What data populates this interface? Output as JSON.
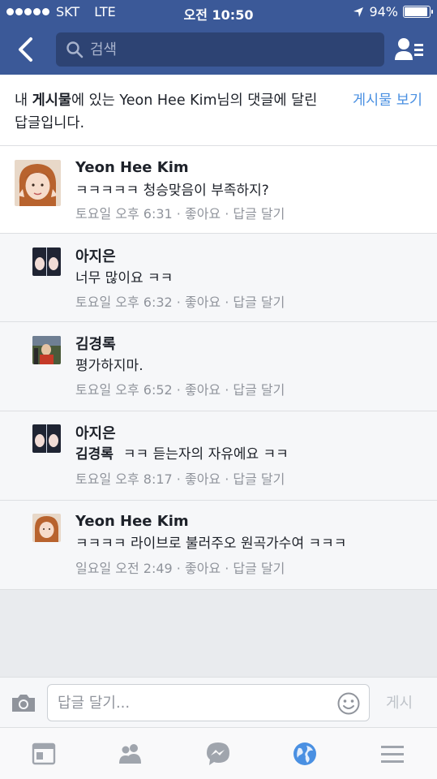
{
  "status_bar": {
    "carrier": "SKT",
    "network": "LTE",
    "time": "오전 10:50",
    "battery": "94%",
    "battery_level": 0.94
  },
  "nav": {
    "search_placeholder": "검색"
  },
  "notice": {
    "prefix": "내 ",
    "bold": "게시물",
    "suffix": "에 있는 Yeon Hee Kim님의 댓글에 달린 답글입니다.",
    "view_link": "게시물 보기"
  },
  "comments": [
    {
      "name": "Yeon Hee Kim",
      "text": "ㅋㅋㅋㅋㅋ 청승맞음이 부족하지?",
      "time": "토요일 오후 6:31",
      "like": "좋아요",
      "reply": "답글 달기"
    },
    {
      "name": "아지은",
      "text": "너무 많이요 ㅋㅋ",
      "time": "토요일 오후 6:32",
      "like": "좋아요",
      "reply": "답글 달기"
    },
    {
      "name": "김경록",
      "text": "평가하지마.",
      "time": "토요일 오후 6:52",
      "like": "좋아요",
      "reply": "답글 달기"
    },
    {
      "name": "아지은",
      "mention": "김경록",
      "text": "ㅋㅋ 듣는자의 자유에요 ㅋㅋ",
      "time": "토요일 오후 8:17",
      "like": "좋아요",
      "reply": "답글 달기"
    },
    {
      "name": "Yeon Hee Kim",
      "text": "ㅋㅋㅋㅋ 라이브로 불러주오 원곡가수여 ㅋㅋㅋ",
      "time": "일요일 오전 2:49",
      "like": "좋아요",
      "reply": "답글 달기"
    }
  ],
  "composer": {
    "placeholder": "답글 달기...",
    "post_label": "게시"
  },
  "tabbar": {
    "icons": [
      "news-feed-icon",
      "friends-icon",
      "messenger-icon",
      "notifications-globe-icon",
      "menu-icon"
    ]
  },
  "colors": {
    "brand": "#3b5998",
    "link": "#4a90e2",
    "meta": "#90949c"
  }
}
